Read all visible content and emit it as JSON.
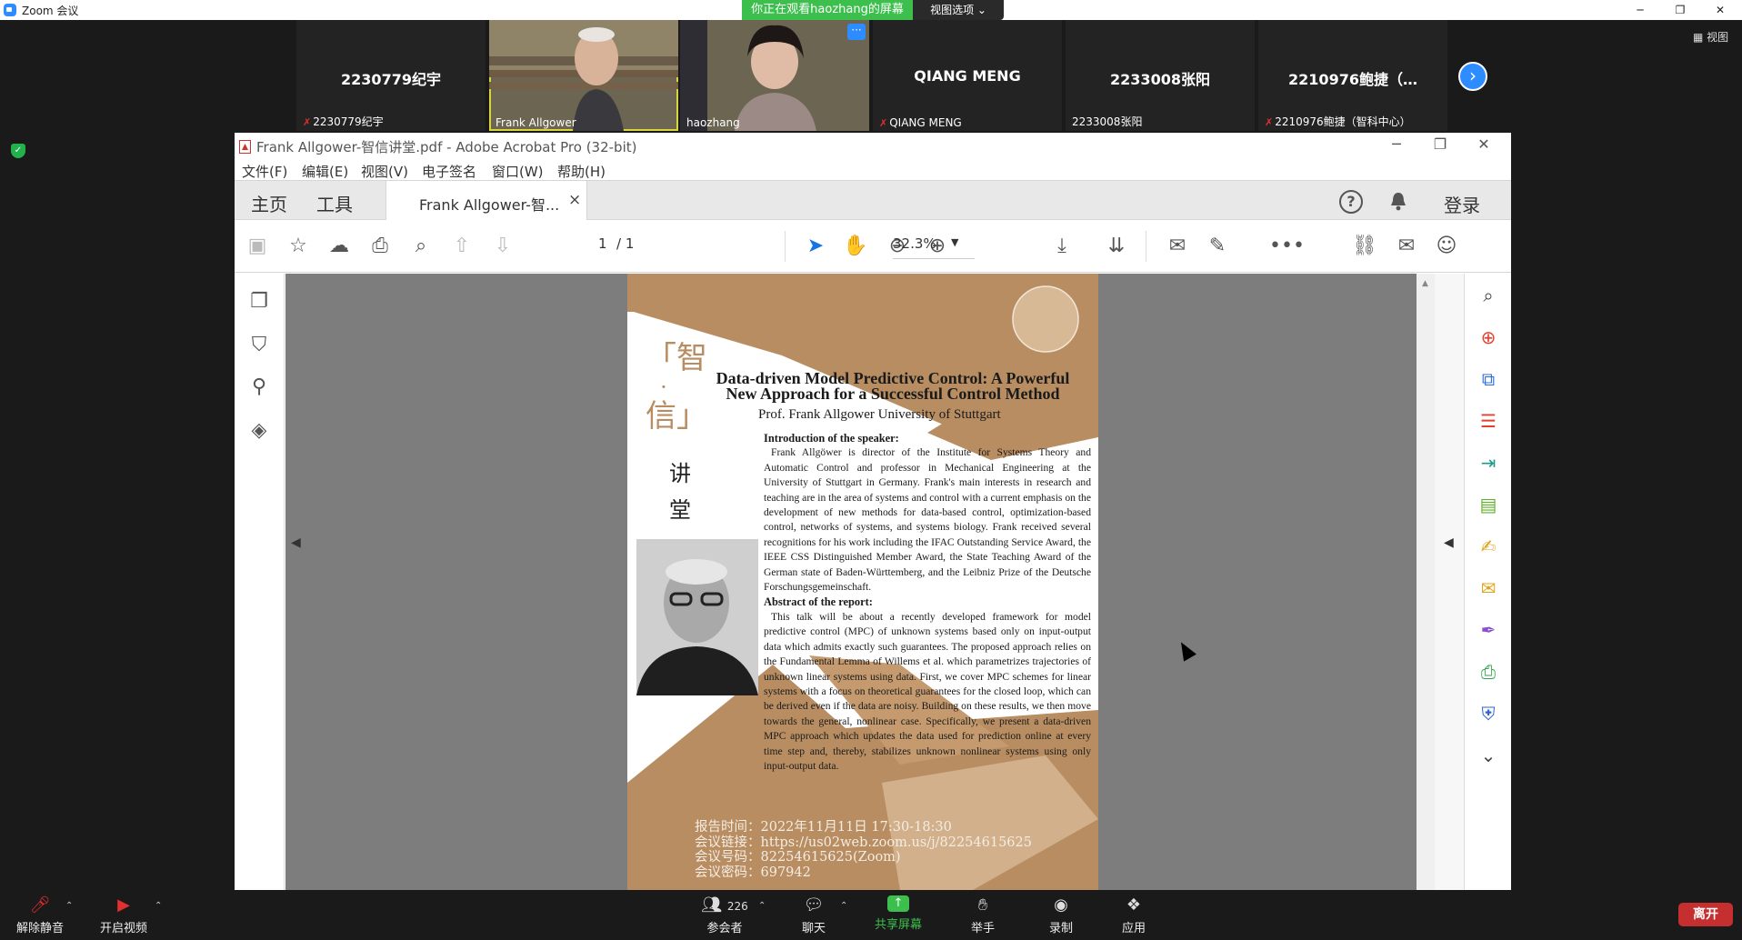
{
  "zoom": {
    "window_title": "Zoom 会议",
    "viewing_banner": "你正在观看haozhang的屏幕",
    "view_options": "视图选项 ⌄",
    "view_button": "视图",
    "participants": [
      {
        "name": "2230779纪宇",
        "label": "2230779纪宇",
        "muted": true,
        "video": false
      },
      {
        "name": "Frank Allgower",
        "label": "Frank Allgower",
        "muted": false,
        "video": true,
        "active": true
      },
      {
        "name": "haozhang",
        "label": "haozhang",
        "muted": false,
        "video": true
      },
      {
        "name": "QIANG MENG",
        "label": "QIANG MENG",
        "muted": true,
        "video": false
      },
      {
        "name": "2233008张阳",
        "label": "2233008张阳",
        "muted": false,
        "video": false
      },
      {
        "name": "2210976鲍捷（…",
        "label": "2210976鲍捷（智科中心）",
        "muted": true,
        "video": false
      }
    ],
    "more_badge": "···",
    "bottom": {
      "unmute": "解除静音",
      "start_video": "开启视频",
      "participants": "参会者",
      "participant_count": "226",
      "chat": "聊天",
      "share": "共享屏幕",
      "raise_hand": "举手",
      "record": "录制",
      "apps": "应用",
      "leave": "离开"
    }
  },
  "acrobat": {
    "title": "Frank Allgower-智信讲堂.pdf - Adobe Acrobat Pro (32-bit)",
    "menus": [
      "文件(F)",
      "编辑(E)",
      "视图(V)",
      "电子签名",
      "窗口(W)",
      "帮助(H)"
    ],
    "tabs": {
      "home": "主页",
      "tools": "工具",
      "document": "Frank Allgower-智...",
      "close": "×"
    },
    "login": "登录",
    "page_current": "1",
    "page_total": "/ 1",
    "zoom_level": "32.3%"
  },
  "pdf": {
    "side_title_1": "「智",
    "side_title_dot": "·",
    "side_title_2": "信」",
    "side_sub_1": "讲",
    "side_sub_2": "堂",
    "title_line1": "Data-driven Model Predictive Control: A Powerful",
    "title_line2": "New Approach for a Successful Control Method",
    "author": "Prof. Frank Allgower  University of Stuttgart",
    "intro_heading": "Introduction of the speaker:",
    "intro_text": "Frank Allgöwer is director of the Institute for Systems Theory and Automatic Control and professor in Mechanical Engineering at the University of Stuttgart in Germany. Frank's main interests in research and teaching are in the area of systems and control with a current emphasis on the development of new methods for data-based control, optimization-based control, networks of systems, and systems biology. Frank received several recognitions for his work including the IFAC Outstanding Service Award, the IEEE CSS Distinguished Member Award, the State Teaching Award of the German state of Baden-Württemberg, and the Leibniz Prize of the Deutsche Forschungsgemeinschaft.",
    "abstract_heading": "Abstract of the report:",
    "abstract_text": "This talk will be about a recently developed framework for model predictive control (MPC) of unknown systems based only on input-output data which admits exactly such guarantees. The proposed approach relies on the Fundamental Lemma of Willems et al. which parametrizes trajectories of unknown linear systems using data. First, we cover MPC schemes for linear systems with a focus on theoretical guarantees for the closed loop, which can be derived even if the data are noisy. Building on these results, we then move towards the general, nonlinear case. Specifically, we present a data-driven MPC approach which updates the data used for prediction online at every time step and, thereby, stabilizes unknown nonlinear systems using only input-output data.",
    "footer_time": "报告时间：2022年11月11日 17:30-18:30",
    "footer_link": "会议链接：https://us02web.zoom.us/j/82254615625",
    "footer_id": "会议号码：82254615625(Zoom)",
    "footer_pwd": "会议密码：697942"
  }
}
